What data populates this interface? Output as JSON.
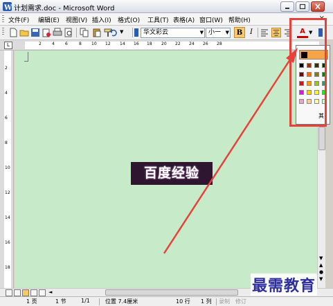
{
  "window": {
    "title": "计划需求.doc - Microsoft Word"
  },
  "menu": {
    "items": [
      "文件(F)",
      "编辑(E)",
      "视图(V)",
      "插入(I)",
      "格式(O)",
      "工具(T)",
      "表格(A)",
      "窗口(W)",
      "帮助(H)"
    ],
    "close_glyph": "×"
  },
  "formatting": {
    "font_name": "华文彩云",
    "font_size": "小一",
    "bold_label": "B",
    "italic_label": "I",
    "font_color_label": "A"
  },
  "ruler": {
    "corner_label": "L",
    "numbers": [
      "2",
      "4",
      "6",
      "8",
      "10",
      "12",
      "14",
      "16",
      "18",
      "20",
      "22",
      "24",
      "26",
      "28"
    ],
    "vertical_numbers": [
      "2",
      "4",
      "6",
      "8",
      "10",
      "12",
      "14",
      "16",
      "18"
    ]
  },
  "document": {
    "word_art_text": "百度经验"
  },
  "color_palette": {
    "rows": [
      [
        "#000000",
        "#993300",
        "#333300",
        "#003300"
      ],
      [
        "#800000",
        "#ff6600",
        "#808000",
        "#008000"
      ],
      [
        "#ff0000",
        "#ff9900",
        "#99cc00",
        "#339966"
      ],
      [
        "#ff00ff",
        "#ffcc00",
        "#ffff00",
        "#00ff00"
      ],
      [
        "#ff99cc",
        "#ffcc99",
        "#ffff99",
        "#ccffcc"
      ]
    ],
    "more_label": "其"
  },
  "statusbar": {
    "page": "1 页",
    "section": "1 节",
    "page_of": "1/1",
    "position": "位置 7.4厘米",
    "line": "10 行",
    "column": "1 列",
    "rec": "录制",
    "trk": "修订"
  },
  "watermark": {
    "text": "最需教育"
  },
  "colors": {
    "document_bg": "#c7ebc8",
    "highlight": "#e8413c",
    "word_art_bg": "#2e1630"
  }
}
